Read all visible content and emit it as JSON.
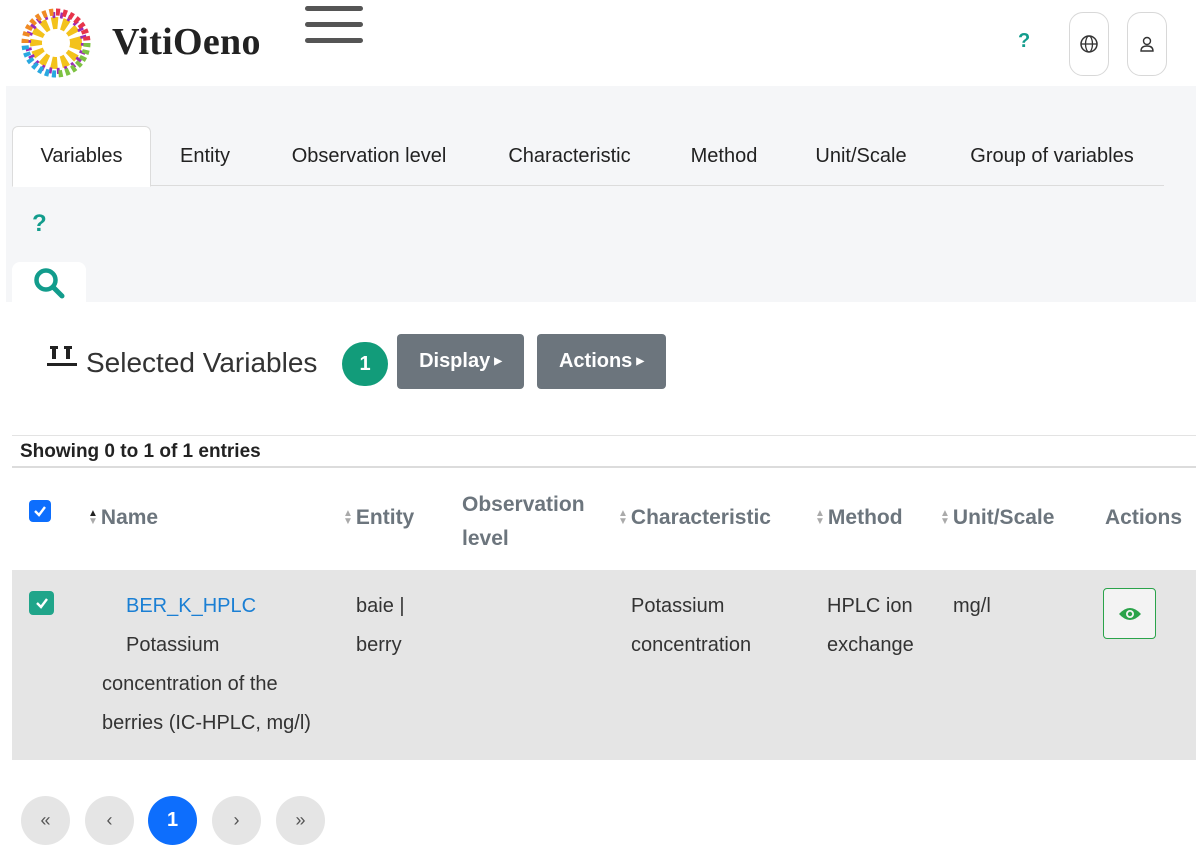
{
  "header": {
    "brand": "VitiOeno",
    "help_label": "?"
  },
  "tabs": [
    {
      "label": "Variables",
      "active": true
    },
    {
      "label": "Entity"
    },
    {
      "label": "Observation level"
    },
    {
      "label": "Characteristic"
    },
    {
      "label": "Method"
    },
    {
      "label": "Unit/Scale"
    },
    {
      "label": "Group of variables"
    }
  ],
  "band": {
    "help_label": "?"
  },
  "selection": {
    "title": "Selected Variables",
    "count": "1",
    "display_label": "Display",
    "actions_label": "Actions"
  },
  "table": {
    "showing": "Showing 0 to 1 of 1 entries",
    "columns": {
      "name": "Name",
      "entity": "Entity",
      "observation_level": "Observation level",
      "characteristic": "Characteristic",
      "method": "Method",
      "unit_scale": "Unit/Scale",
      "actions": "Actions"
    },
    "rows": [
      {
        "checked": true,
        "code": "BER_K_HPLC",
        "description": "Potassium concentration of the berries (IC-HPLC, mg/l)",
        "entity": "baie | berry",
        "observation_level": "",
        "characteristic": "Potassium concentration",
        "method": "HPLC ion exchange",
        "unit_scale": "mg/l"
      }
    ]
  },
  "pagination": {
    "first": "«",
    "prev": "‹",
    "current": "1",
    "next": "›",
    "last": "»"
  },
  "colors": {
    "teal": "#129c8c",
    "badge": "#129c7a",
    "primary": "#0d6efd",
    "dark_button": "#6c757d",
    "link": "#1a7fd4",
    "view_green": "#2aa34a"
  }
}
